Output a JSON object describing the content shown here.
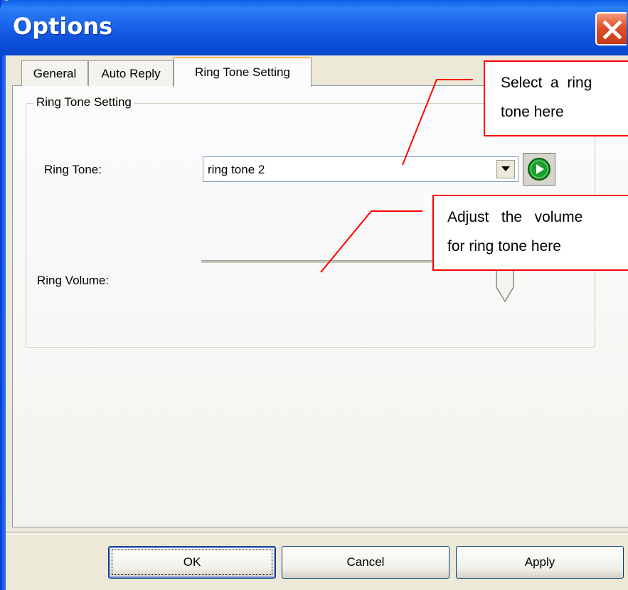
{
  "window": {
    "title": "Options"
  },
  "tabs": [
    {
      "label": "General"
    },
    {
      "label": "Auto Reply"
    },
    {
      "label": "Ring Tone Setting",
      "active": true
    }
  ],
  "group": {
    "title": "Ring Tone Setting"
  },
  "ring_tone": {
    "label": "Ring Tone:",
    "value": "ring tone 2"
  },
  "ring_volume": {
    "label": "Ring Volume:",
    "level_fraction": 0.8
  },
  "callouts": [
    {
      "lines": [
        "Select  a  ring",
        "tone here"
      ]
    },
    {
      "lines": [
        "Adjust   the   volume",
        "for ring tone here"
      ]
    }
  ],
  "buttons": {
    "ok": "OK",
    "cancel": "Cancel",
    "apply": "Apply"
  },
  "icons": {
    "close": "close-icon",
    "play": "play-icon",
    "dropdown": "chevron-down-icon"
  },
  "colors": {
    "titlebar": "#0A5FE8",
    "close": "#E0502C",
    "callout_border": "#FF0000",
    "play": "#1E9E2E"
  }
}
